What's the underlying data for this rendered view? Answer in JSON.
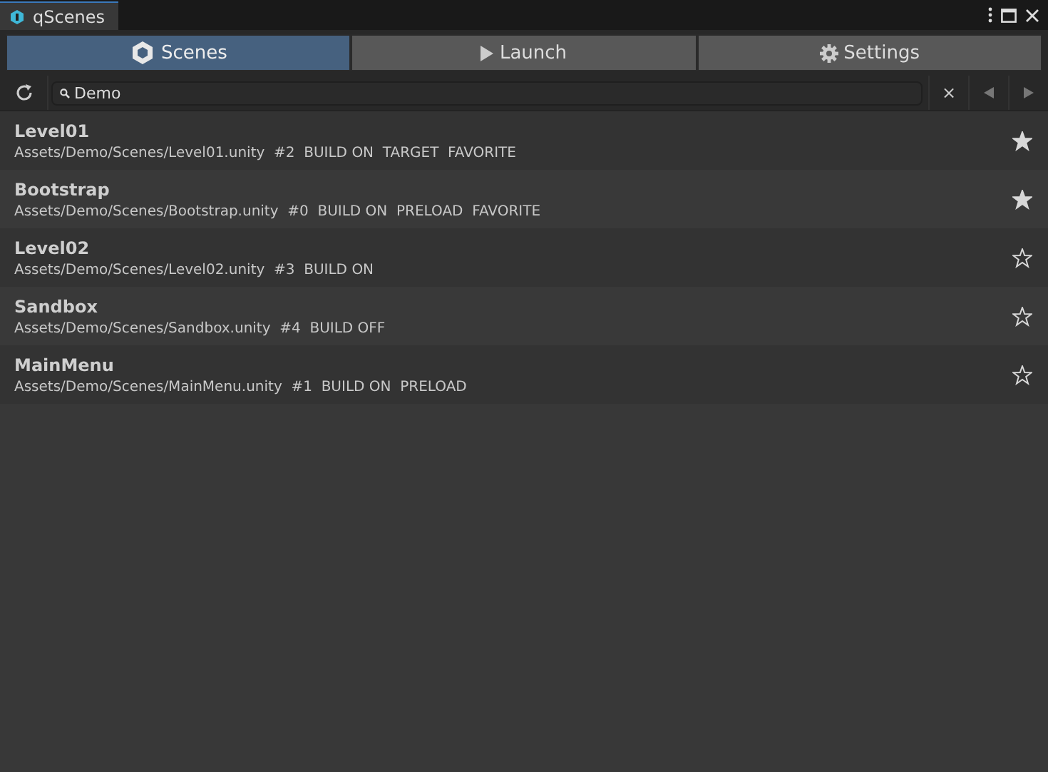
{
  "window": {
    "title": "qScenes"
  },
  "tabs": [
    {
      "label": "Scenes",
      "selected": true
    },
    {
      "label": "Launch",
      "selected": false
    },
    {
      "label": "Settings",
      "selected": false
    }
  ],
  "search": {
    "value": "Demo",
    "clear": "×"
  },
  "scenes": [
    {
      "name": "Level01",
      "path": "Assets/Demo/Scenes/Level01.unity  #2  BUILD ON  TARGET  FAVORITE",
      "favorite": true
    },
    {
      "name": "Bootstrap",
      "path": "Assets/Demo/Scenes/Bootstrap.unity  #0  BUILD ON  PRELOAD  FAVORITE",
      "favorite": true
    },
    {
      "name": "Level02",
      "path": "Assets/Demo/Scenes/Level02.unity  #3  BUILD ON",
      "favorite": false
    },
    {
      "name": "Sandbox",
      "path": "Assets/Demo/Scenes/Sandbox.unity  #4  BUILD OFF",
      "favorite": false
    },
    {
      "name": "MainMenu",
      "path": "Assets/Demo/Scenes/MainMenu.unity  #1  BUILD ON  PRELOAD",
      "favorite": false
    }
  ]
}
